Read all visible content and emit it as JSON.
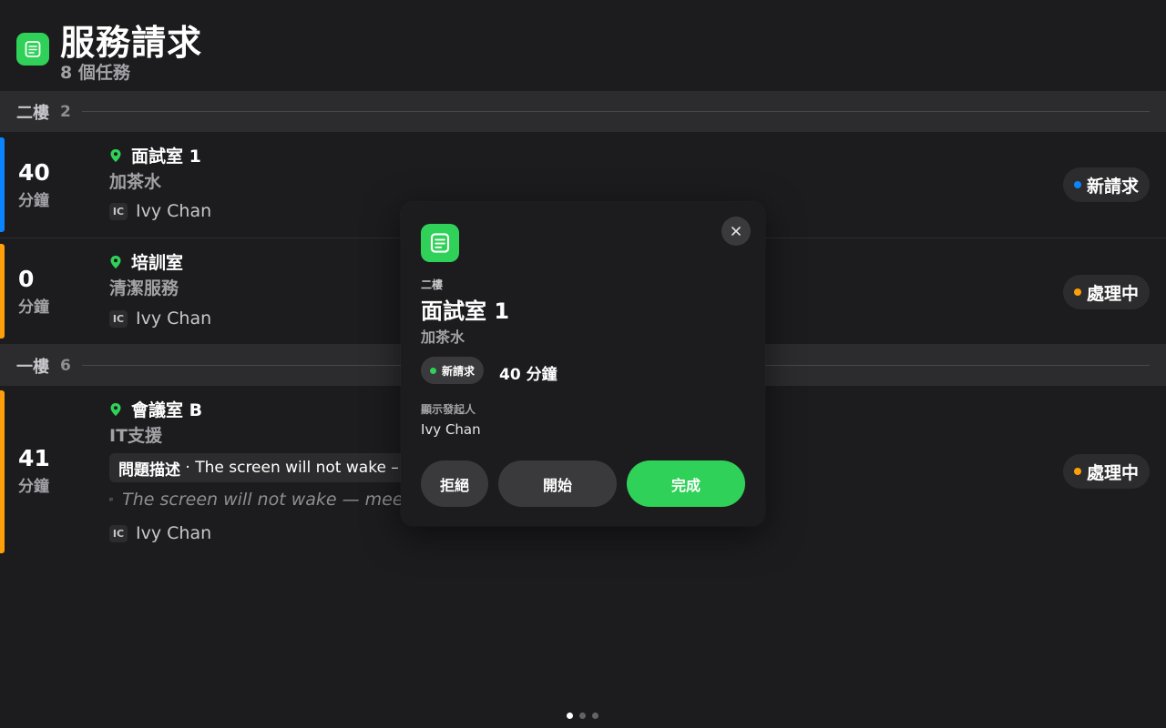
{
  "header": {
    "title": "服務請求",
    "subtitle": "8 個任務",
    "icon": "note-icon",
    "accent_color": "#30d158"
  },
  "sections": [
    {
      "name": "二樓",
      "count": "2",
      "rows": [
        {
          "minutes": "40",
          "minutes_unit": "分鐘",
          "location": "面試室 1",
          "service": "加茶水",
          "requester_initials": "IC",
          "requester": "Ivy Chan",
          "status": "新請求",
          "status_color": "#0a84ff",
          "bar_color": "#0a84ff"
        },
        {
          "minutes": "0",
          "minutes_unit": "分鐘",
          "location": "培訓室",
          "service": "清潔服務",
          "requester_initials": "IC",
          "requester": "Ivy Chan",
          "status": "處理中",
          "status_color": "#ff9f0a",
          "bar_color": "#ff9f0a"
        }
      ]
    },
    {
      "name": "一樓",
      "count": "6",
      "rows": [
        {
          "minutes": "41",
          "minutes_unit": "分鐘",
          "location": "會議室 B",
          "service": "IT支援",
          "description_label": "問題描述",
          "description_sep": " · ",
          "description_text": "The screen will not wake –",
          "note": "The screen will not wake — meet",
          "requester_initials": "IC",
          "requester": "Ivy Chan",
          "status": "處理中",
          "status_color": "#ff9f0a",
          "bar_color": "#ff9f0a"
        }
      ]
    }
  ],
  "modal": {
    "icon": "note-icon",
    "floor": "二樓",
    "room": "面試室 1",
    "service": "加茶水",
    "status": "新請求",
    "status_color": "#30d158",
    "minutes_text": "40 分鐘",
    "requester_label": "顯示發起人",
    "requester": "Ivy Chan",
    "buttons": {
      "reject": "拒絕",
      "start": "開始",
      "done": "完成"
    },
    "close_icon": "close-icon"
  },
  "pager": {
    "pages": 3,
    "current": 1
  }
}
